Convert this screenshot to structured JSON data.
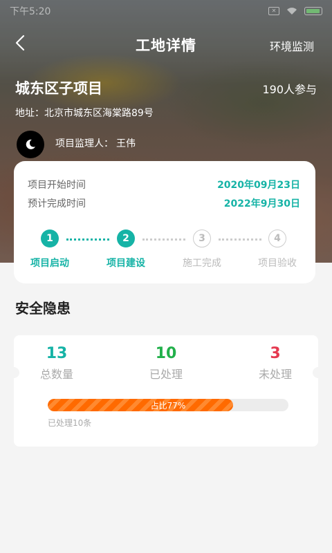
{
  "status_bar": {
    "time": "下午5:20"
  },
  "nav": {
    "title": "工地详情",
    "right_link": "环境监测"
  },
  "project": {
    "name": "城东区子项目",
    "participants": "190人参与",
    "address_label": "地址：",
    "address": "北京市城东区海棠路89号",
    "supervisor_label": "项目监理人：",
    "supervisor": "王伟"
  },
  "schedule": {
    "start_label": "项目开始时间",
    "start_date": "2020年09月23日",
    "end_label": "预计完成时间",
    "end_date": "2022年9月30日"
  },
  "steps": [
    {
      "num": "1",
      "label": "项目启动",
      "state": "active"
    },
    {
      "num": "2",
      "label": "项目建设",
      "state": "active"
    },
    {
      "num": "3",
      "label": "施工完成",
      "state": "inactive"
    },
    {
      "num": "4",
      "label": "项目验收",
      "state": "inactive"
    }
  ],
  "safety": {
    "section_title": "安全隐患",
    "total": {
      "value": "13",
      "label": "总数量",
      "color": "#16b3a6"
    },
    "handled": {
      "value": "10",
      "label": "已处理",
      "color": "#22b04b"
    },
    "unhandled": {
      "value": "3",
      "label": "未处理",
      "color": "#e53950"
    },
    "progress_percent": 77,
    "progress_text": "占比77%",
    "processed_note": "已处理10条"
  },
  "icons": {
    "back": "chevron-left-icon",
    "avatar": "moon-icon"
  }
}
